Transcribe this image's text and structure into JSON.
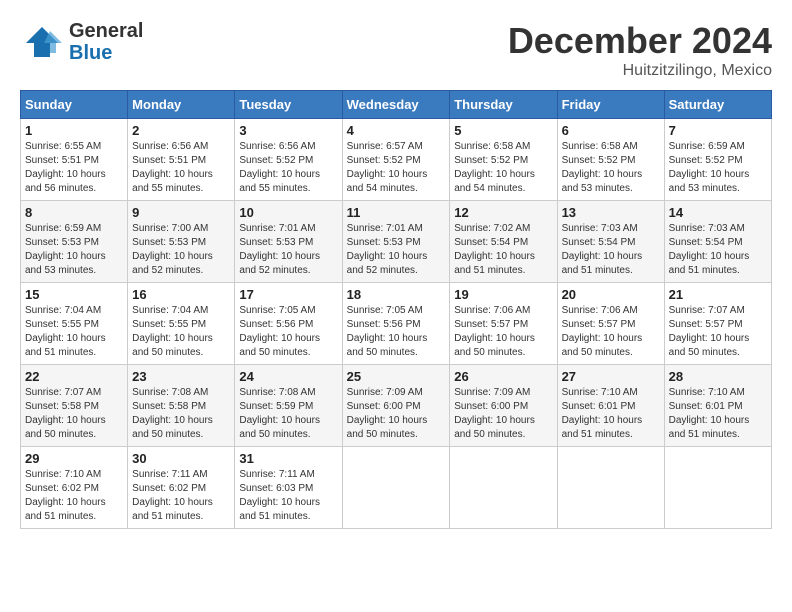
{
  "header": {
    "logo_line1": "General",
    "logo_line2": "Blue",
    "month": "December 2024",
    "location": "Huitzitzilingo, Mexico"
  },
  "weekdays": [
    "Sunday",
    "Monday",
    "Tuesday",
    "Wednesday",
    "Thursday",
    "Friday",
    "Saturday"
  ],
  "weeks": [
    [
      {
        "day": "1",
        "sunrise": "6:55 AM",
        "sunset": "5:51 PM",
        "daylight": "10 hours and 56 minutes."
      },
      {
        "day": "2",
        "sunrise": "6:56 AM",
        "sunset": "5:51 PM",
        "daylight": "10 hours and 55 minutes."
      },
      {
        "day": "3",
        "sunrise": "6:56 AM",
        "sunset": "5:52 PM",
        "daylight": "10 hours and 55 minutes."
      },
      {
        "day": "4",
        "sunrise": "6:57 AM",
        "sunset": "5:52 PM",
        "daylight": "10 hours and 54 minutes."
      },
      {
        "day": "5",
        "sunrise": "6:58 AM",
        "sunset": "5:52 PM",
        "daylight": "10 hours and 54 minutes."
      },
      {
        "day": "6",
        "sunrise": "6:58 AM",
        "sunset": "5:52 PM",
        "daylight": "10 hours and 53 minutes."
      },
      {
        "day": "7",
        "sunrise": "6:59 AM",
        "sunset": "5:52 PM",
        "daylight": "10 hours and 53 minutes."
      }
    ],
    [
      {
        "day": "8",
        "sunrise": "6:59 AM",
        "sunset": "5:53 PM",
        "daylight": "10 hours and 53 minutes."
      },
      {
        "day": "9",
        "sunrise": "7:00 AM",
        "sunset": "5:53 PM",
        "daylight": "10 hours and 52 minutes."
      },
      {
        "day": "10",
        "sunrise": "7:01 AM",
        "sunset": "5:53 PM",
        "daylight": "10 hours and 52 minutes."
      },
      {
        "day": "11",
        "sunrise": "7:01 AM",
        "sunset": "5:53 PM",
        "daylight": "10 hours and 52 minutes."
      },
      {
        "day": "12",
        "sunrise": "7:02 AM",
        "sunset": "5:54 PM",
        "daylight": "10 hours and 51 minutes."
      },
      {
        "day": "13",
        "sunrise": "7:03 AM",
        "sunset": "5:54 PM",
        "daylight": "10 hours and 51 minutes."
      },
      {
        "day": "14",
        "sunrise": "7:03 AM",
        "sunset": "5:54 PM",
        "daylight": "10 hours and 51 minutes."
      }
    ],
    [
      {
        "day": "15",
        "sunrise": "7:04 AM",
        "sunset": "5:55 PM",
        "daylight": "10 hours and 51 minutes."
      },
      {
        "day": "16",
        "sunrise": "7:04 AM",
        "sunset": "5:55 PM",
        "daylight": "10 hours and 50 minutes."
      },
      {
        "day": "17",
        "sunrise": "7:05 AM",
        "sunset": "5:56 PM",
        "daylight": "10 hours and 50 minutes."
      },
      {
        "day": "18",
        "sunrise": "7:05 AM",
        "sunset": "5:56 PM",
        "daylight": "10 hours and 50 minutes."
      },
      {
        "day": "19",
        "sunrise": "7:06 AM",
        "sunset": "5:57 PM",
        "daylight": "10 hours and 50 minutes."
      },
      {
        "day": "20",
        "sunrise": "7:06 AM",
        "sunset": "5:57 PM",
        "daylight": "10 hours and 50 minutes."
      },
      {
        "day": "21",
        "sunrise": "7:07 AM",
        "sunset": "5:57 PM",
        "daylight": "10 hours and 50 minutes."
      }
    ],
    [
      {
        "day": "22",
        "sunrise": "7:07 AM",
        "sunset": "5:58 PM",
        "daylight": "10 hours and 50 minutes."
      },
      {
        "day": "23",
        "sunrise": "7:08 AM",
        "sunset": "5:58 PM",
        "daylight": "10 hours and 50 minutes."
      },
      {
        "day": "24",
        "sunrise": "7:08 AM",
        "sunset": "5:59 PM",
        "daylight": "10 hours and 50 minutes."
      },
      {
        "day": "25",
        "sunrise": "7:09 AM",
        "sunset": "6:00 PM",
        "daylight": "10 hours and 50 minutes."
      },
      {
        "day": "26",
        "sunrise": "7:09 AM",
        "sunset": "6:00 PM",
        "daylight": "10 hours and 50 minutes."
      },
      {
        "day": "27",
        "sunrise": "7:10 AM",
        "sunset": "6:01 PM",
        "daylight": "10 hours and 51 minutes."
      },
      {
        "day": "28",
        "sunrise": "7:10 AM",
        "sunset": "6:01 PM",
        "daylight": "10 hours and 51 minutes."
      }
    ],
    [
      {
        "day": "29",
        "sunrise": "7:10 AM",
        "sunset": "6:02 PM",
        "daylight": "10 hours and 51 minutes."
      },
      {
        "day": "30",
        "sunrise": "7:11 AM",
        "sunset": "6:02 PM",
        "daylight": "10 hours and 51 minutes."
      },
      {
        "day": "31",
        "sunrise": "7:11 AM",
        "sunset": "6:03 PM",
        "daylight": "10 hours and 51 minutes."
      },
      null,
      null,
      null,
      null
    ]
  ],
  "labels": {
    "sunrise": "Sunrise:",
    "sunset": "Sunset:",
    "daylight": "Daylight:"
  }
}
